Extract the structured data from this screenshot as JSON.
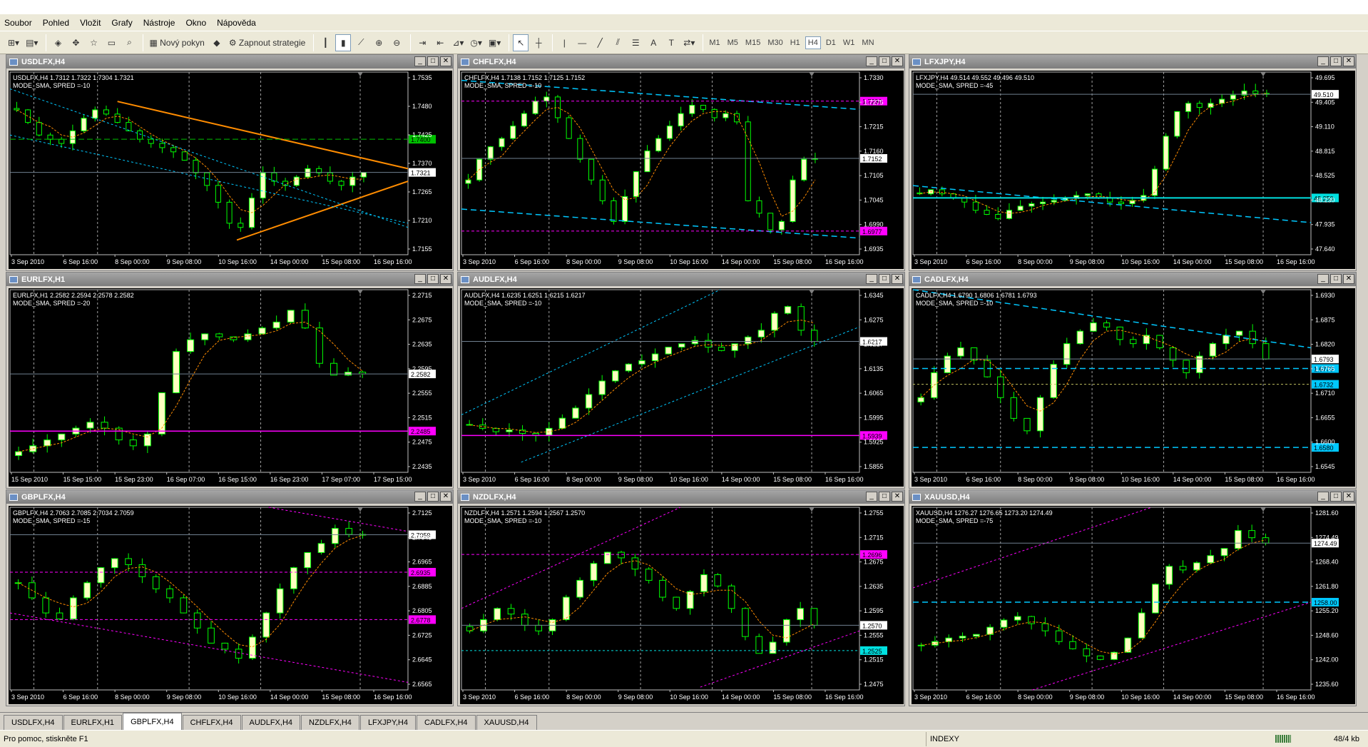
{
  "menu": [
    "Soubor",
    "Pohled",
    "Vložit",
    "Grafy",
    "Nástroje",
    "Okno",
    "Nápověda"
  ],
  "toolbar": {
    "new_order": "Nový pokyn",
    "expert_advisors": "Zapnout strategie",
    "timeframes": [
      "M1",
      "M5",
      "M15",
      "M30",
      "H1",
      "H4",
      "D1",
      "W1",
      "MN"
    ]
  },
  "tabs": [
    "USDLFX,H4",
    "EURLFX,H1",
    "GBPLFX,H4",
    "CHFLFX,H4",
    "AUDLFX,H4",
    "NZDLFX,H4",
    "LFXJPY,H4",
    "CADLFX,H4",
    "XAUUSD,H4"
  ],
  "status": {
    "help": "Pro pomoc, stiskněte F1",
    "profile": "INDEXY",
    "traffic": "48/4 kb"
  },
  "colors": {
    "bull": "#ffffc0",
    "bear": "#000000",
    "wick": "#00ff00",
    "ma": "#ff8c00",
    "magenta": "#ff00ff",
    "cyan": "#00c8ff",
    "green_label": "#00c000",
    "price_line": "#708090"
  },
  "chart_data": [
    {
      "type": "candlestick",
      "window_title": "USDLFX,H4",
      "info_line": "USDLFX,H4 1.7312 1.7322 1.7304 1.7321",
      "info_line2": "MODE_SMA, SPRED =-10",
      "y_ticks": [
        "1.7535",
        "1.7480",
        "1.7425",
        "1.7370",
        "1.7265",
        "1.7210",
        "1.7155"
      ],
      "ylim": [
        1.7125,
        1.756
      ],
      "x_ticks": [
        "3 Sep 2010",
        "6 Sep 16:00",
        "8 Sep 00:00",
        "9 Sep 08:00",
        "10 Sep 16:00",
        "14 Sep 00:00",
        "15 Sep 08:00",
        "16 Sep 16:00"
      ],
      "prices": [
        1.747,
        1.744,
        1.741,
        1.74,
        1.739,
        1.742,
        1.745,
        1.747,
        1.746,
        1.744,
        1.742,
        1.74,
        1.739,
        1.738,
        1.737,
        1.735,
        1.732,
        1.729,
        1.725,
        1.72,
        1.719,
        1.726,
        1.732,
        1.73,
        1.729,
        1.731,
        1.733,
        1.732,
        1.73,
        1.729,
        1.731,
        1.7321
      ],
      "current": {
        "label": "1.7321",
        "value": 1.7321
      },
      "hlines": [
        {
          "value": 1.74,
          "color": "#00c000",
          "label": "1.7400",
          "dash": "8,4"
        }
      ],
      "lines": [
        {
          "x1": 0.27,
          "y1": 1.749,
          "x2": 1.0,
          "y2": 1.733,
          "color": "#ff8c00",
          "w": 2,
          "dash": ""
        },
        {
          "x1": 0.57,
          "y1": 1.716,
          "x2": 1.0,
          "y2": 1.73,
          "color": "#ff8c00",
          "w": 2,
          "dash": ""
        },
        {
          "x1": 0.0,
          "y1": 1.752,
          "x2": 1.0,
          "y2": 1.719,
          "color": "#00c8ff",
          "w": 1,
          "dash": "3,3"
        },
        {
          "x1": 0.0,
          "y1": 1.741,
          "x2": 1.0,
          "y2": 1.72,
          "color": "#00c8ff",
          "w": 1,
          "dash": "3,3"
        }
      ],
      "vlines": [
        0.06,
        0.22,
        0.45,
        0.63,
        0.88
      ]
    },
    {
      "type": "candlestick",
      "window_title": "CHFLFX,H4",
      "info_line": "CHFLFX,H4 1.7138 1.7152 1.7125 1.7152",
      "info_line2": "MODE_SMA, SPRED =-10",
      "y_ticks": [
        "1.7330",
        "1.7275",
        "1.7215",
        "1.7160",
        "1.7105",
        "1.7045",
        "1.6990",
        "1.6935"
      ],
      "ylim": [
        1.692,
        1.736
      ],
      "x_ticks": [
        "3 Sep 2010",
        "6 Sep 16:00",
        "8 Sep 00:00",
        "9 Sep 08:00",
        "10 Sep 16:00",
        "14 Sep 00:00",
        "15 Sep 08:00",
        "16 Sep 16:00"
      ],
      "prices": [
        1.71,
        1.715,
        1.718,
        1.72,
        1.723,
        1.726,
        1.729,
        1.73,
        1.725,
        1.72,
        1.715,
        1.71,
        1.705,
        1.7,
        1.706,
        1.712,
        1.717,
        1.72,
        1.723,
        1.726,
        1.728,
        1.727,
        1.725,
        1.726,
        1.724,
        1.705,
        1.702,
        1.698,
        1.7,
        1.71,
        1.715,
        1.7152
      ],
      "current": {
        "label": "1.7152",
        "value": 1.7152
      },
      "hlines": [
        {
          "value": 1.729,
          "color": "#ff00ff",
          "label": "1.7290",
          "dash": "4,3"
        },
        {
          "value": 1.6977,
          "color": "#ff00ff",
          "label": "1.6977",
          "dash": "4,3"
        }
      ],
      "lines": [
        {
          "x1": 0.0,
          "y1": 1.734,
          "x2": 1.0,
          "y2": 1.727,
          "color": "#00c8ff",
          "w": 1.5,
          "dash": "8,5"
        },
        {
          "x1": 0.0,
          "y1": 1.703,
          "x2": 1.0,
          "y2": 1.696,
          "color": "#00c8ff",
          "w": 1.5,
          "dash": "8,5"
        }
      ],
      "vlines": [
        0.06,
        0.22,
        0.45,
        0.63,
        0.88
      ]
    },
    {
      "type": "candlestick",
      "window_title": "LFXJPY,H4",
      "info_line": "LFXJPY,H4 49.514 49.552 49.496 49.510",
      "info_line2": "MODE_SMA, SPRED =-45",
      "y_ticks": [
        "49.695",
        "49.405",
        "49.110",
        "48.815",
        "48.525",
        "48.230",
        "47.935",
        "47.640"
      ],
      "ylim": [
        47.56,
        49.78
      ],
      "x_ticks": [
        "3 Sep 2010",
        "6 Sep 16:00",
        "8 Sep 00:00",
        "9 Sep 08:00",
        "10 Sep 16:00",
        "14 Sep 00:00",
        "15 Sep 08:00",
        "16 Sep 16:00"
      ],
      "prices": [
        48.3,
        48.35,
        48.3,
        48.25,
        48.2,
        48.1,
        48.05,
        48.0,
        48.1,
        48.15,
        48.18,
        48.2,
        48.22,
        48.25,
        48.28,
        48.3,
        48.25,
        48.2,
        48.18,
        48.22,
        48.28,
        48.6,
        49.0,
        49.3,
        49.4,
        49.35,
        49.4,
        49.45,
        49.5,
        49.55,
        49.52,
        49.51
      ],
      "current": {
        "label": "49.510",
        "value": 49.51
      },
      "hlines": [
        {
          "value": 48.25,
          "color": "#00e0e0",
          "label": "48.250",
          "dash": "",
          "w": 2
        }
      ],
      "lines": [
        {
          "x1": 0.0,
          "y1": 48.4,
          "x2": 1.0,
          "y2": 47.95,
          "color": "#00c8ff",
          "w": 1.5,
          "dash": "8,5"
        }
      ],
      "vlines": [
        0.06,
        0.22,
        0.45,
        0.63,
        0.88
      ]
    },
    {
      "type": "candlestick",
      "window_title": "EURLFX,H1",
      "info_line": "EURLFX,H1 2.2582 2.2594 2.2578 2.2582",
      "info_line2": "MODE_SMA, SPRED =-20",
      "y_ticks": [
        "2.2715",
        "2.2675",
        "2.2635",
        "2.2595",
        "2.2555",
        "2.2515",
        "2.2475",
        "2.2435"
      ],
      "ylim": [
        2.2415,
        2.2725
      ],
      "x_ticks": [
        "15 Sep 2010",
        "15 Sep 15:00",
        "15 Sep 23:00",
        "16 Sep 07:00",
        "16 Sep 15:00",
        "16 Sep 23:00",
        "17 Sep 07:00",
        "17 Sep 15:00"
      ],
      "prices": [
        2.245,
        2.246,
        2.247,
        2.248,
        2.249,
        2.25,
        2.249,
        2.247,
        2.246,
        2.248,
        2.255,
        2.262,
        2.264,
        2.265,
        2.2645,
        2.264,
        2.265,
        2.266,
        2.267,
        2.269,
        2.266,
        2.26,
        2.258,
        2.2585,
        2.2582
      ],
      "current": {
        "label": "2.2582",
        "value": 2.2582
      },
      "hlines": [
        {
          "value": 2.2485,
          "color": "#ff00ff",
          "label": "2.2485",
          "dash": "",
          "w": 1.5
        }
      ],
      "lines": [],
      "vlines": [
        0.06,
        0.22,
        0.45,
        0.63,
        0.88
      ]
    },
    {
      "type": "candlestick",
      "window_title": "AUDLFX,H4",
      "info_line": "AUDLFX,H4 1.6235 1.6251 1.6215 1.6217",
      "info_line2": "MODE_SMA, SPRED =-10",
      "y_ticks": [
        "1.6345",
        "1.6275",
        "1.6217",
        "1.6135",
        "1.6065",
        "1.5995",
        "1.5925",
        "1.5855"
      ],
      "ylim": [
        1.583,
        1.637
      ],
      "x_ticks": [
        "3 Sep 2010",
        "6 Sep 16:00",
        "8 Sep 00:00",
        "9 Sep 08:00",
        "10 Sep 16:00",
        "14 Sep 00:00",
        "15 Sep 08:00",
        "16 Sep 16:00"
      ],
      "prices": [
        1.597,
        1.596,
        1.595,
        1.5955,
        1.5945,
        1.594,
        1.596,
        1.599,
        1.602,
        1.606,
        1.61,
        1.613,
        1.615,
        1.616,
        1.618,
        1.62,
        1.621,
        1.622,
        1.62,
        1.619,
        1.621,
        1.623,
        1.625,
        1.63,
        1.632,
        1.625,
        1.6217
      ],
      "current": {
        "label": "1.6217",
        "value": 1.6217
      },
      "hlines": [
        {
          "value": 1.5939,
          "color": "#ff00ff",
          "label": "1.5939",
          "dash": "",
          "w": 1.5
        }
      ],
      "lines": [
        {
          "x1": 0.0,
          "y1": 1.6,
          "x2": 0.65,
          "y2": 1.637,
          "color": "#00c8ff",
          "w": 1,
          "dash": "3,3"
        },
        {
          "x1": 0.15,
          "y1": 1.586,
          "x2": 1.0,
          "y2": 1.626,
          "color": "#00c8ff",
          "w": 1,
          "dash": "3,3"
        }
      ],
      "vlines": [
        0.06,
        0.22,
        0.45,
        0.63,
        0.88
      ]
    },
    {
      "type": "candlestick",
      "window_title": "CADLFX,H4",
      "info_line": "CADLFX,H4 1.6790 1.6806 1.6781 1.6793",
      "info_line2": "MODE_SMA, SPRED =-10",
      "y_ticks": [
        "1.6930",
        "1.6875",
        "1.6820",
        "1.6765",
        "1.6710",
        "1.6655",
        "1.6600",
        "1.6545"
      ],
      "ylim": [
        1.652,
        1.696
      ],
      "x_ticks": [
        "3 Sep 2010",
        "6 Sep 16:00",
        "8 Sep 00:00",
        "9 Sep 08:00",
        "10 Sep 16:00",
        "14 Sep 00:00",
        "15 Sep 08:00",
        "16 Sep 16:00"
      ],
      "prices": [
        1.67,
        1.676,
        1.68,
        1.682,
        1.679,
        1.675,
        1.67,
        1.665,
        1.662,
        1.67,
        1.678,
        1.683,
        1.686,
        1.688,
        1.687,
        1.684,
        1.683,
        1.685,
        1.682,
        1.679,
        1.676,
        1.68,
        1.683,
        1.685,
        1.686,
        1.683,
        1.6793
      ],
      "current": {
        "label": "1.6793",
        "value": 1.6793
      },
      "hlines": [
        {
          "value": 1.677,
          "color": "#00c8ff",
          "label": "1.6770",
          "dash": "8,5",
          "w": 1.5
        },
        {
          "value": 1.6732,
          "color": "#c0c060",
          "label": "1.6732",
          "dash": "3,3",
          "w": 1,
          "labelcolor": "#00c8ff"
        },
        {
          "value": 1.658,
          "color": "#00c8ff",
          "label": "1.6580",
          "dash": "8,5",
          "w": 1.5
        }
      ],
      "lines": [
        {
          "x1": 0.0,
          "y1": 1.696,
          "x2": 1.0,
          "y2": 1.682,
          "color": "#00c8ff",
          "w": 1.5,
          "dash": "8,5"
        }
      ],
      "vlines": [
        0.06,
        0.22,
        0.45,
        0.63,
        0.88
      ]
    },
    {
      "type": "candlestick",
      "window_title": "GBPLFX,H4",
      "info_line": "GBPLFX,H4 2.7063 2.7085 2.7034 2.7059",
      "info_line2": "MODE_SMA, SPRED =-15",
      "y_ticks": [
        "2.7125",
        "2.7045",
        "2.6965",
        "2.6885",
        "2.6805",
        "2.6725",
        "2.6645",
        "2.6565"
      ],
      "ylim": [
        2.6545,
        2.715
      ],
      "x_ticks": [
        "3 Sep 2010",
        "6 Sep 16:00",
        "8 Sep 00:00",
        "9 Sep 08:00",
        "10 Sep 16:00",
        "14 Sep 00:00",
        "15 Sep 08:00",
        "16 Sep 16:00"
      ],
      "prices": [
        2.69,
        2.685,
        2.68,
        2.678,
        2.685,
        2.69,
        2.695,
        2.698,
        2.696,
        2.692,
        2.688,
        2.685,
        2.68,
        2.675,
        2.67,
        2.668,
        2.665,
        2.672,
        2.68,
        2.688,
        2.695,
        2.7,
        2.703,
        2.708,
        2.706,
        2.7059
      ],
      "current": {
        "label": "2.7059",
        "value": 2.7059
      },
      "hlines": [
        {
          "value": 2.6935,
          "color": "#ff00ff",
          "label": "2.6935",
          "dash": "4,3"
        },
        {
          "value": 2.6778,
          "color": "#ff00ff",
          "label": "2.6778",
          "dash": "4,3"
        }
      ],
      "lines": [
        {
          "x1": 0.0,
          "y1": 2.68,
          "x2": 1.0,
          "y2": 2.657,
          "color": "#ff00ff",
          "w": 1,
          "dash": "3,3"
        },
        {
          "x1": 0.65,
          "y1": 2.715,
          "x2": 1.0,
          "y2": 2.707,
          "color": "#ff00ff",
          "w": 1,
          "dash": "3,3"
        }
      ],
      "vlines": [
        0.06,
        0.22,
        0.45,
        0.63,
        0.88
      ]
    },
    {
      "type": "candlestick",
      "window_title": "NZDLFX,H4",
      "info_line": "NZDLFX,H4 1.2571 1.2594 1.2567 1.2570",
      "info_line2": "MODE_SMA, SPRED =-10",
      "y_ticks": [
        "1.2755",
        "1.2715",
        "1.2675",
        "1.2635",
        "1.2595",
        "1.2555",
        "1.2515",
        "1.2475"
      ],
      "ylim": [
        1.2455,
        1.278
      ],
      "x_ticks": [
        "3 Sep 2010",
        "6 Sep 16:00",
        "8 Sep 00:00",
        "9 Sep 08:00",
        "10 Sep 16:00",
        "14 Sep 00:00",
        "15 Sep 08:00",
        "16 Sep 16:00"
      ],
      "prices": [
        1.256,
        1.258,
        1.26,
        1.259,
        1.257,
        1.256,
        1.258,
        1.262,
        1.265,
        1.268,
        1.27,
        1.269,
        1.267,
        1.265,
        1.262,
        1.26,
        1.263,
        1.266,
        1.264,
        1.26,
        1.255,
        1.252,
        1.254,
        1.258,
        1.26,
        1.257
      ],
      "current": {
        "label": "1.2570",
        "value": 1.257
      },
      "hlines": [
        {
          "value": 1.2696,
          "color": "#ff00ff",
          "label": "1.2696",
          "dash": "4,3"
        },
        {
          "value": 1.2525,
          "color": "#00e0e0",
          "label": "1.2525",
          "dash": "3,3"
        }
      ],
      "lines": [
        {
          "x1": 0.0,
          "y1": 1.26,
          "x2": 0.55,
          "y2": 1.278,
          "color": "#ff00ff",
          "w": 1,
          "dash": "3,3"
        },
        {
          "x1": 0.6,
          "y1": 1.246,
          "x2": 1.0,
          "y2": 1.256,
          "color": "#ff00ff",
          "w": 1,
          "dash": "3,3"
        }
      ],
      "vlines": [
        0.06,
        0.22,
        0.45,
        0.63,
        0.88
      ]
    },
    {
      "type": "candlestick",
      "window_title": "XAUUSD,H4",
      "info_line": "XAUUSD,H4 1276.27 1276.65 1273.20 1274.49",
      "info_line2": "MODE_SMA, SPRED =-75",
      "y_ticks": [
        "1281.60",
        "1274.49",
        "1268.40",
        "1261.80",
        "1255.20",
        "1248.60",
        "1242.00",
        "1235.60"
      ],
      "ylim": [
        1233.5,
        1284.5
      ],
      "x_ticks": [
        "3 Sep 2010",
        "6 Sep 16:00",
        "8 Sep 00:00",
        "9 Sep 08:00",
        "10 Sep 16:00",
        "14 Sep 00:00",
        "15 Sep 08:00",
        "16 Sep 16:00"
      ],
      "prices": [
        1246.0,
        1247.0,
        1248.0,
        1248.5,
        1249.0,
        1251.0,
        1253.0,
        1254.0,
        1252.0,
        1250.0,
        1247.0,
        1245.0,
        1243.0,
        1242.0,
        1244.0,
        1248.0,
        1255.0,
        1263.0,
        1268.0,
        1267.0,
        1269.0,
        1271.0,
        1273.0,
        1278.0,
        1276.0,
        1274.49
      ],
      "current": {
        "label": "1274.49",
        "value": 1274.49
      },
      "hlines": [
        {
          "value": 1258.0,
          "color": "#00c8ff",
          "label": "1258.00",
          "dash": "8,5",
          "w": 1.5
        }
      ],
      "lines": [
        {
          "x1": 0.0,
          "y1": 1262.0,
          "x2": 0.6,
          "y2": 1284.5,
          "color": "#ff00ff",
          "w": 1,
          "dash": "3,3"
        },
        {
          "x1": 0.3,
          "y1": 1233.5,
          "x2": 1.0,
          "y2": 1258.0,
          "color": "#ff00ff",
          "w": 1,
          "dash": "3,3"
        }
      ],
      "vlines": [
        0.06,
        0.22,
        0.45,
        0.63,
        0.88
      ]
    }
  ]
}
